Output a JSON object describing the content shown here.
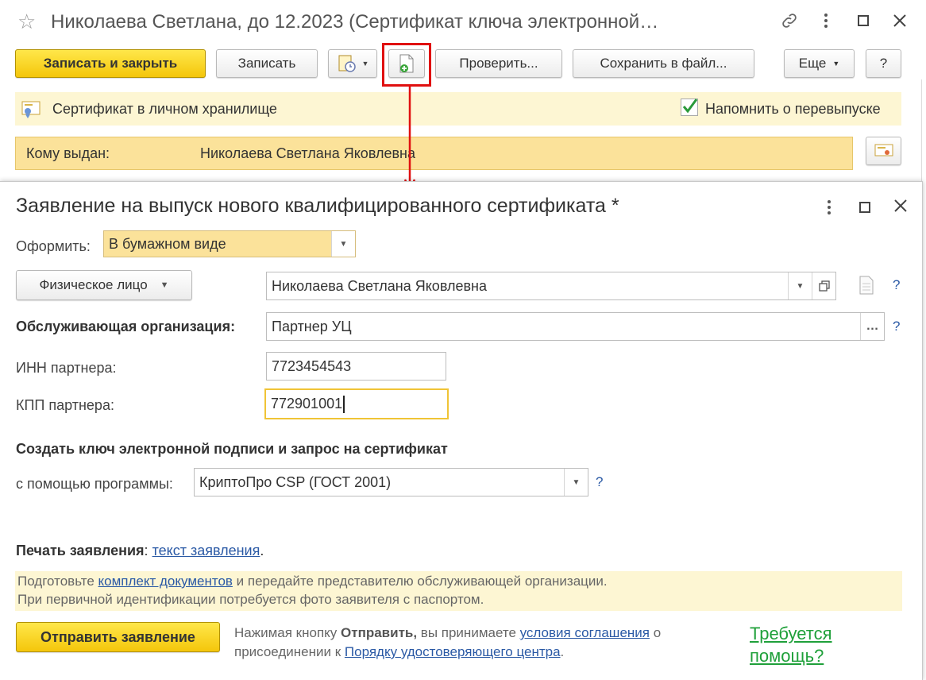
{
  "back_window": {
    "title": "Николаева Светлана, до 12.2023 (Сертификат ключа электронной…",
    "buttons": {
      "save_close": "Записать и закрыть",
      "save": "Записать",
      "check": "Проверить...",
      "save_to_file": "Сохранить в файл...",
      "more": "Еще",
      "help": "?"
    },
    "info_bar": {
      "text": "Сертификат в личном хранилище",
      "reminder_label": "Напомнить о перевыпуске",
      "reminder_checked": true
    },
    "issued_to": {
      "label": "Кому выдан:",
      "value": "Николаева Светлана Яковлевна"
    }
  },
  "dialog": {
    "title": "Заявление на выпуск нового квалифицированного сертификата *",
    "form_type": {
      "label": "Оформить:",
      "value": "В бумажном виде"
    },
    "person_type": {
      "value": "Физическое лицо"
    },
    "person": {
      "value": "Николаева Светлана Яковлевна"
    },
    "service_org": {
      "label": "Обслуживающая организация:",
      "value": "Партнер УЦ"
    },
    "partner_inn": {
      "label": "ИНН партнера:",
      "value": "7723454543"
    },
    "partner_kpp": {
      "label": "КПП партнера:",
      "value": "772901001"
    },
    "create_key_heading": "Создать ключ электронной подписи и запрос на сертификат",
    "program": {
      "label": "с помощью программы:",
      "value": "КриптоПро CSP (ГОСТ 2001)"
    },
    "print": {
      "label": "Печать заявления",
      "link": "текст заявления"
    },
    "notice": {
      "prefix": "Подготовьте ",
      "link": "комплект документов",
      "suffix": " и передайте представителю обслуживающей организации.",
      "line2": "При первичной идентификации потребуется фото заявителя с паспортом."
    },
    "send_button": "Отправить заявление",
    "agreement": {
      "part1": "Нажимая кнопку ",
      "bold": "Отправить,",
      "part2": " вы принимаете ",
      "link1": "условия соглашения",
      "part3": " о",
      "part4": "присоединении к ",
      "link2": "Порядку удостоверяющего центра",
      "part5": "."
    },
    "help_link_line1": "Требуется",
    "help_link_line2": "помощь?",
    "qmark": "?"
  },
  "colors": {
    "primary_button": "#f4c60b",
    "highlight_red": "#e01010",
    "link_blue": "#2a59a5",
    "help_green": "#1fa03a",
    "notice_bg": "#fdf6d3"
  }
}
